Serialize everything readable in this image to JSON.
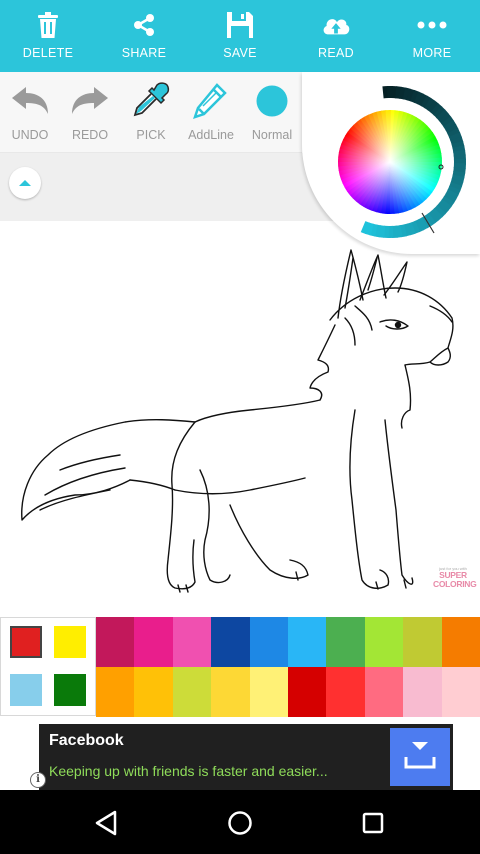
{
  "topbar": {
    "color": "#2cc5da",
    "items": [
      {
        "label": "DELETE",
        "icon": "trash-icon"
      },
      {
        "label": "SHARE",
        "icon": "share-icon"
      },
      {
        "label": "SAVE",
        "icon": "save-icon"
      },
      {
        "label": "READ",
        "icon": "cloud-upload-icon"
      },
      {
        "label": "MORE",
        "icon": "more-icon"
      }
    ]
  },
  "tools": [
    {
      "label": "UNDO",
      "icon": "undo-icon"
    },
    {
      "label": "REDO",
      "icon": "redo-icon"
    },
    {
      "label": "PICK",
      "icon": "eyedropper-icon"
    },
    {
      "label": "AddLine",
      "icon": "pencil-icon"
    },
    {
      "label": "Normal",
      "icon": "brush-dot-icon"
    }
  ],
  "collapse_icon": "chevron-up-icon",
  "selected_color": "#2cc5da",
  "color_wheel": {
    "brightness_icon": "brightness-ring"
  },
  "watermark": {
    "small": "just for you with",
    "line1": "SUPER",
    "line2": "COLORING"
  },
  "palette": {
    "recent": [
      "#e02020",
      "#ffee00",
      "#87ceeb",
      "#0a7a0a"
    ],
    "row1": [
      "#c2185b",
      "#e91e8c",
      "#f050b0",
      "#0d47a1",
      "#1e88e5",
      "#29b6f6",
      "#4caf50",
      "#a3e635",
      "#c0ca33",
      "#f57c00"
    ],
    "row2": [
      "#ffa000",
      "#ffc107",
      "#cddc39",
      "#fdd835",
      "#fff176",
      "#d50000",
      "#ff3030",
      "#ff6b81",
      "#f8bbd0",
      "#ffcdd2"
    ]
  },
  "ad": {
    "title": "Facebook",
    "text": "Keeping up with friends is faster and easier...",
    "info": "i",
    "download_icon": "download-icon"
  },
  "navbar": {
    "back_icon": "back-triangle-icon",
    "home_icon": "home-circle-icon",
    "recents_icon": "recents-square-icon"
  }
}
